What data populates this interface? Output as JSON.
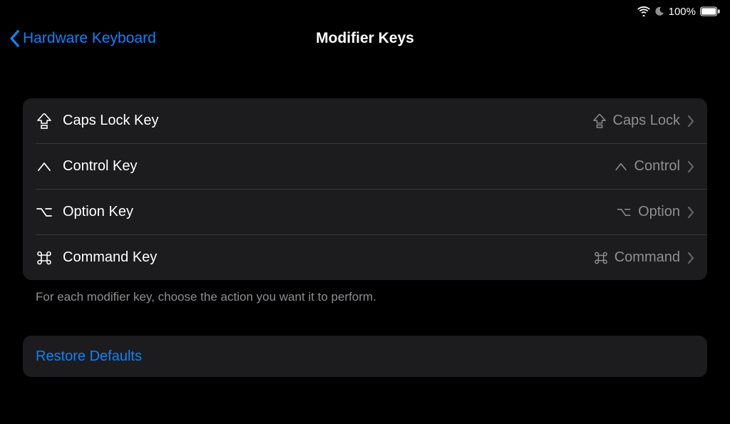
{
  "status": {
    "battery_percent": "100%"
  },
  "nav": {
    "back_label": "Hardware Keyboard",
    "title": "Modifier Keys"
  },
  "rows": [
    {
      "label": "Caps Lock Key",
      "value": "Caps Lock"
    },
    {
      "label": "Control Key",
      "value": "Control"
    },
    {
      "label": "Option Key",
      "value": "Option"
    },
    {
      "label": "Command Key",
      "value": "Command"
    }
  ],
  "footer": "For each modifier key, choose the action you want it to perform.",
  "restore_label": "Restore Defaults"
}
